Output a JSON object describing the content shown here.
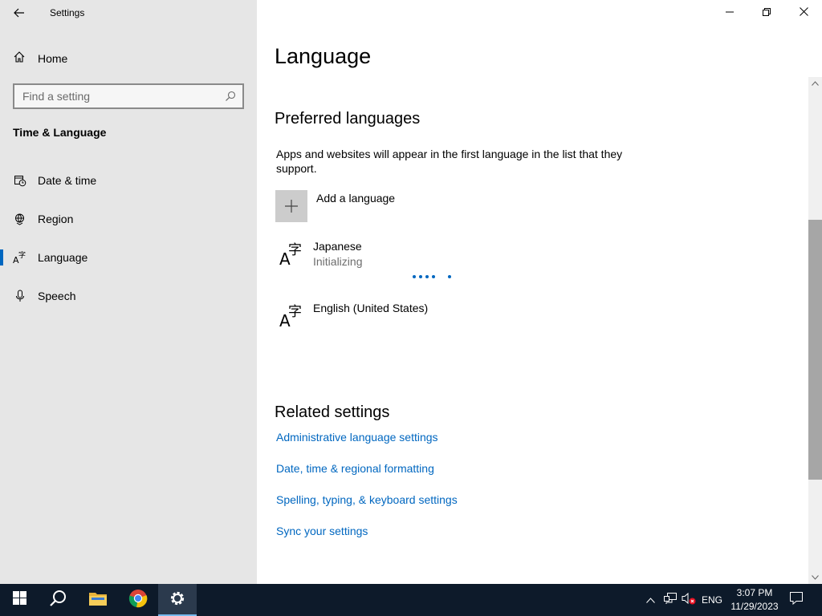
{
  "window": {
    "title": "Settings",
    "controls": [
      "minimize",
      "restore",
      "close"
    ]
  },
  "sidebar": {
    "home_label": "Home",
    "search_placeholder": "Find a setting",
    "section_title": "Time & Language",
    "items": [
      {
        "label": "Date & time",
        "icon": "clock-calendar-icon"
      },
      {
        "label": "Region",
        "icon": "globe-icon"
      },
      {
        "label": "Language",
        "icon": "language-icon",
        "selected": true
      },
      {
        "label": "Speech",
        "icon": "microphone-icon"
      }
    ]
  },
  "main": {
    "page_title": "Language",
    "preferred_heading": "Preferred languages",
    "description": "Apps and websites will appear in the first language in the list that they support.",
    "add_language_label": "Add a language",
    "languages": [
      {
        "name": "Japanese",
        "status": "Initializing"
      },
      {
        "name": "English (United States)",
        "status": ""
      }
    ],
    "related_heading": "Related settings",
    "related_links": [
      "Administrative language settings",
      "Date, time & regional formatting",
      "Spelling, typing, & keyboard settings",
      "Sync your settings"
    ]
  },
  "taskbar": {
    "apps": [
      "start-icon",
      "search-icon",
      "file-explorer-icon",
      "chrome-icon",
      "settings-icon"
    ],
    "active_app": "settings-icon",
    "language_indicator": "ENG",
    "time": "3:07 PM",
    "date": "11/29/2023"
  },
  "colors": {
    "sidebar_bg": "#e6e6e6",
    "accent": "#0067c0",
    "taskbar_bg": "#0d1a2a"
  }
}
